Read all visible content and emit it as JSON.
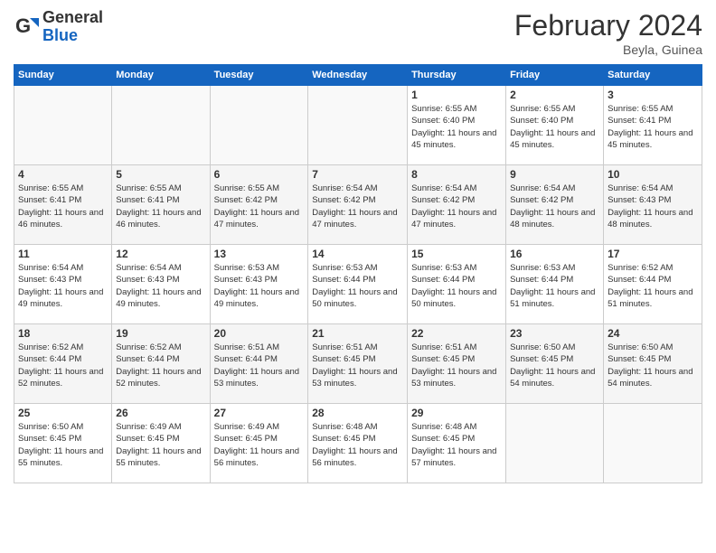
{
  "header": {
    "logo_general": "General",
    "logo_blue": "Blue",
    "month_title": "February 2024",
    "subtitle": "Beyla, Guinea"
  },
  "days_of_week": [
    "Sunday",
    "Monday",
    "Tuesday",
    "Wednesday",
    "Thursday",
    "Friday",
    "Saturday"
  ],
  "weeks": [
    [
      {
        "day": "",
        "empty": true
      },
      {
        "day": "",
        "empty": true
      },
      {
        "day": "",
        "empty": true
      },
      {
        "day": "",
        "empty": true
      },
      {
        "day": "1",
        "sunrise": "6:55 AM",
        "sunset": "6:40 PM",
        "daylight": "11 hours and 45 minutes."
      },
      {
        "day": "2",
        "sunrise": "6:55 AM",
        "sunset": "6:40 PM",
        "daylight": "11 hours and 45 minutes."
      },
      {
        "day": "3",
        "sunrise": "6:55 AM",
        "sunset": "6:41 PM",
        "daylight": "11 hours and 45 minutes."
      }
    ],
    [
      {
        "day": "4",
        "sunrise": "6:55 AM",
        "sunset": "6:41 PM",
        "daylight": "11 hours and 46 minutes."
      },
      {
        "day": "5",
        "sunrise": "6:55 AM",
        "sunset": "6:41 PM",
        "daylight": "11 hours and 46 minutes."
      },
      {
        "day": "6",
        "sunrise": "6:55 AM",
        "sunset": "6:42 PM",
        "daylight": "11 hours and 47 minutes."
      },
      {
        "day": "7",
        "sunrise": "6:54 AM",
        "sunset": "6:42 PM",
        "daylight": "11 hours and 47 minutes."
      },
      {
        "day": "8",
        "sunrise": "6:54 AM",
        "sunset": "6:42 PM",
        "daylight": "11 hours and 47 minutes."
      },
      {
        "day": "9",
        "sunrise": "6:54 AM",
        "sunset": "6:42 PM",
        "daylight": "11 hours and 48 minutes."
      },
      {
        "day": "10",
        "sunrise": "6:54 AM",
        "sunset": "6:43 PM",
        "daylight": "11 hours and 48 minutes."
      }
    ],
    [
      {
        "day": "11",
        "sunrise": "6:54 AM",
        "sunset": "6:43 PM",
        "daylight": "11 hours and 49 minutes."
      },
      {
        "day": "12",
        "sunrise": "6:54 AM",
        "sunset": "6:43 PM",
        "daylight": "11 hours and 49 minutes."
      },
      {
        "day": "13",
        "sunrise": "6:53 AM",
        "sunset": "6:43 PM",
        "daylight": "11 hours and 49 minutes."
      },
      {
        "day": "14",
        "sunrise": "6:53 AM",
        "sunset": "6:44 PM",
        "daylight": "11 hours and 50 minutes."
      },
      {
        "day": "15",
        "sunrise": "6:53 AM",
        "sunset": "6:44 PM",
        "daylight": "11 hours and 50 minutes."
      },
      {
        "day": "16",
        "sunrise": "6:53 AM",
        "sunset": "6:44 PM",
        "daylight": "11 hours and 51 minutes."
      },
      {
        "day": "17",
        "sunrise": "6:52 AM",
        "sunset": "6:44 PM",
        "daylight": "11 hours and 51 minutes."
      }
    ],
    [
      {
        "day": "18",
        "sunrise": "6:52 AM",
        "sunset": "6:44 PM",
        "daylight": "11 hours and 52 minutes."
      },
      {
        "day": "19",
        "sunrise": "6:52 AM",
        "sunset": "6:44 PM",
        "daylight": "11 hours and 52 minutes."
      },
      {
        "day": "20",
        "sunrise": "6:51 AM",
        "sunset": "6:44 PM",
        "daylight": "11 hours and 53 minutes."
      },
      {
        "day": "21",
        "sunrise": "6:51 AM",
        "sunset": "6:45 PM",
        "daylight": "11 hours and 53 minutes."
      },
      {
        "day": "22",
        "sunrise": "6:51 AM",
        "sunset": "6:45 PM",
        "daylight": "11 hours and 53 minutes."
      },
      {
        "day": "23",
        "sunrise": "6:50 AM",
        "sunset": "6:45 PM",
        "daylight": "11 hours and 54 minutes."
      },
      {
        "day": "24",
        "sunrise": "6:50 AM",
        "sunset": "6:45 PM",
        "daylight": "11 hours and 54 minutes."
      }
    ],
    [
      {
        "day": "25",
        "sunrise": "6:50 AM",
        "sunset": "6:45 PM",
        "daylight": "11 hours and 55 minutes."
      },
      {
        "day": "26",
        "sunrise": "6:49 AM",
        "sunset": "6:45 PM",
        "daylight": "11 hours and 55 minutes."
      },
      {
        "day": "27",
        "sunrise": "6:49 AM",
        "sunset": "6:45 PM",
        "daylight": "11 hours and 56 minutes."
      },
      {
        "day": "28",
        "sunrise": "6:48 AM",
        "sunset": "6:45 PM",
        "daylight": "11 hours and 56 minutes."
      },
      {
        "day": "29",
        "sunrise": "6:48 AM",
        "sunset": "6:45 PM",
        "daylight": "11 hours and 57 minutes."
      },
      {
        "day": "",
        "empty": true
      },
      {
        "day": "",
        "empty": true
      }
    ]
  ],
  "labels": {
    "sunrise": "Sunrise: ",
    "sunset": "Sunset: ",
    "daylight": "Daylight: "
  }
}
